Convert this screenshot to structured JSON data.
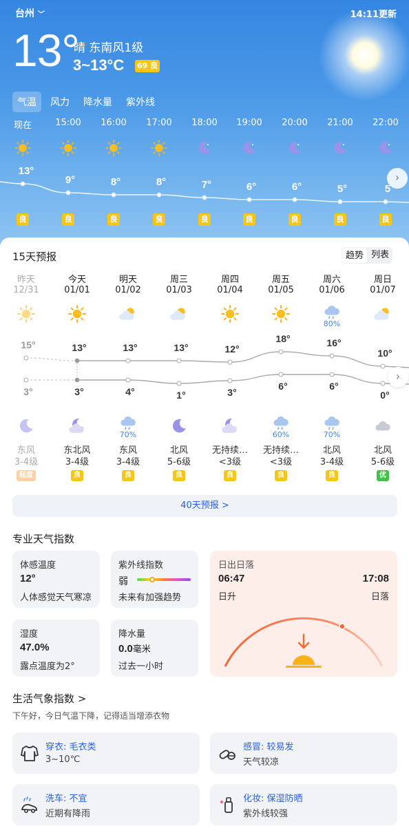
{
  "header": {
    "city": "台州",
    "updated": "14:11更新",
    "current_temp": "13°",
    "condition": "晴  东南风1级",
    "range": "3~13°C",
    "aqi": "69 良",
    "tabs": [
      "气温",
      "风力",
      "降水量",
      "紫外线"
    ]
  },
  "hourly": [
    {
      "time": "现在",
      "icon": "sun-icon",
      "temp": "13°",
      "aqi": "良"
    },
    {
      "time": "15:00",
      "icon": "sun-icon",
      "temp": "9°",
      "aqi": "良"
    },
    {
      "time": "16:00",
      "icon": "sun-icon",
      "temp": "8°",
      "aqi": "良"
    },
    {
      "time": "17:00",
      "icon": "sun-icon",
      "temp": "8°",
      "aqi": "良"
    },
    {
      "time": "18:00",
      "icon": "moon-icon",
      "temp": "7°",
      "aqi": "良"
    },
    {
      "time": "19:00",
      "icon": "moon-icon",
      "temp": "6°",
      "aqi": "良"
    },
    {
      "time": "20:00",
      "icon": "moon-icon",
      "temp": "6°",
      "aqi": "良"
    },
    {
      "time": "21:00",
      "icon": "moon-icon",
      "temp": "5°",
      "aqi": "良"
    },
    {
      "time": "22:00",
      "icon": "moon-icon",
      "temp": "5",
      "aqi": "良"
    }
  ],
  "forecast": {
    "title": "15天预报",
    "toggle": [
      "趋势",
      "列表"
    ],
    "days": [
      {
        "day": "昨天",
        "date": "12/31",
        "icon": "sun-icon",
        "high": "15°",
        "low": "3°",
        "night_icon": "moon-icon",
        "precip": "",
        "wind": "东风",
        "level": "3-4级",
        "aqi": "轻度",
        "past": true
      },
      {
        "day": "今天",
        "date": "01/01",
        "icon": "sun-icon",
        "high": "13°",
        "low": "3°",
        "night_icon": "moon-cloud-icon",
        "precip": "",
        "wind": "东北风",
        "level": "3-4级",
        "aqi": "良"
      },
      {
        "day": "明天",
        "date": "01/02",
        "icon": "partly-cloudy-icon",
        "high": "13°",
        "low": "4°",
        "night_icon": "rain-cloud-icon",
        "precip": "70%",
        "wind": "东风",
        "level": "3-4级",
        "aqi": "良"
      },
      {
        "day": "周三",
        "date": "01/03",
        "icon": "partly-cloudy-icon",
        "high": "13°",
        "low": "1°",
        "night_icon": "moon-icon",
        "precip": "",
        "wind": "北风",
        "level": "5-6级",
        "aqi": "良"
      },
      {
        "day": "周四",
        "date": "01/04",
        "icon": "sun-icon",
        "high": "12°",
        "low": "3°",
        "night_icon": "moon-cloud-icon",
        "precip": "",
        "wind": "无持续…",
        "level": "<3级",
        "aqi": "良"
      },
      {
        "day": "周五",
        "date": "01/05",
        "icon": "sun-icon",
        "high": "18°",
        "low": "6°",
        "night_icon": "rain-cloud-icon",
        "precip": "60%",
        "wind": "无持续…",
        "level": "<3级",
        "aqi": "良"
      },
      {
        "day": "周六",
        "date": "01/06",
        "icon": "rain-cloud-icon",
        "day_precip": "80%",
        "high": "16°",
        "low": "6°",
        "night_icon": "rain-cloud-icon",
        "precip": "70%",
        "wind": "北风",
        "level": "3-4级",
        "aqi": "良"
      },
      {
        "day": "周日",
        "date": "01/07",
        "icon": "partly-cloudy-icon",
        "high": "10°",
        "low": "0°",
        "night_icon": "cloud-icon",
        "precip": "",
        "wind": "北风",
        "level": "5-6级",
        "aqi": "优"
      }
    ],
    "more": "40天预报 >"
  },
  "indices": {
    "title": "专业天气指数",
    "feels": {
      "label": "体感温度",
      "value": "12°",
      "note": "人体感觉天气寒凉"
    },
    "uv": {
      "label": "紫外线指数",
      "value": "弱",
      "note": "未来有加强趋势"
    },
    "humidity": {
      "label": "湿度",
      "value": "47.0%",
      "note": "露点温度为2°"
    },
    "precip": {
      "label": "降水量",
      "value": "0.0",
      "unit": "毫米",
      "note": "过去一小时"
    },
    "sun": {
      "label": "日出日落",
      "sunrise": "06:47",
      "sunrise_label": "日升",
      "sunset": "17:08",
      "sunset_label": "日落"
    }
  },
  "life": {
    "title": "生活气象指数 >",
    "greeting": "下午好，今日气温下降，记得适当增添衣物",
    "items": [
      {
        "title": "穿衣: 毛衣类",
        "desc": "3~10℃",
        "icon": "sweater-icon"
      },
      {
        "title": "感冒: 较易发",
        "desc": "天气较凉",
        "icon": "pills-icon"
      },
      {
        "title": "洗车: 不宜",
        "desc": "近期有降雨",
        "icon": "car-wash-icon"
      },
      {
        "title": "化妆: 保湿防晒",
        "desc": "紫外线较强",
        "icon": "cosmetics-icon"
      }
    ]
  },
  "colors": {
    "accent": "#2c5fd8",
    "aqi_good": "#f5c518",
    "aqi_excellent": "#3ec24a",
    "aqi_light": "#f7b36b",
    "sunset_arc": "#f06a3a"
  }
}
